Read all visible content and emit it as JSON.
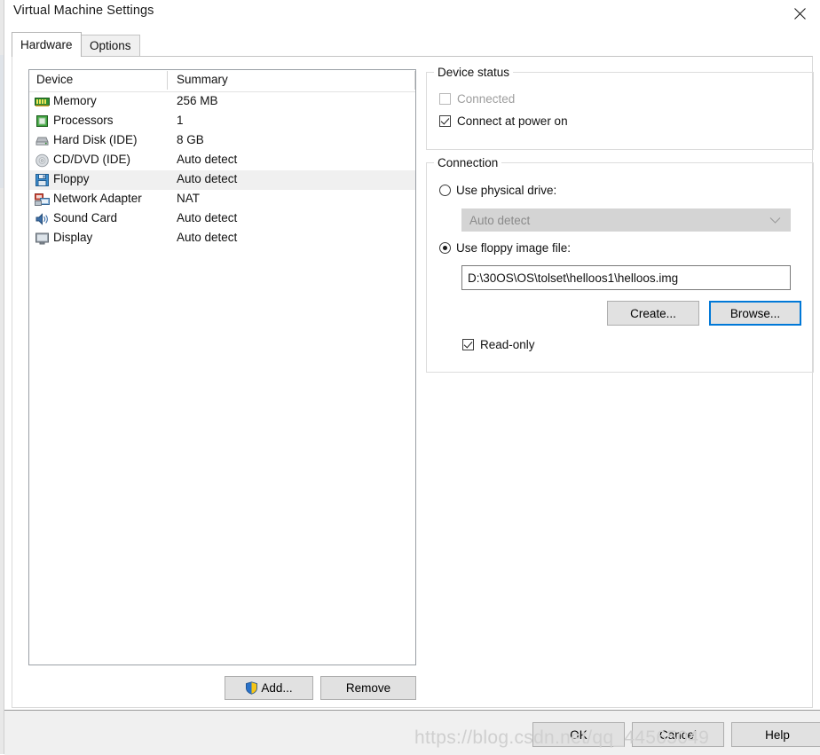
{
  "window": {
    "title": "Virtual Machine Settings",
    "close_icon": "close-icon"
  },
  "tabs": [
    {
      "label": "Hardware",
      "active": true
    },
    {
      "label": "Options",
      "active": false
    }
  ],
  "device_list": {
    "columns": [
      "Device",
      "Summary"
    ],
    "rows": [
      {
        "icon": "memory-icon",
        "device": "Memory",
        "summary": "256 MB",
        "selected": false
      },
      {
        "icon": "processor-icon",
        "device": "Processors",
        "summary": "1",
        "selected": false
      },
      {
        "icon": "hard-disk-icon",
        "device": "Hard Disk (IDE)",
        "summary": "8 GB",
        "selected": false
      },
      {
        "icon": "cd-dvd-icon",
        "device": "CD/DVD (IDE)",
        "summary": "Auto detect",
        "selected": false
      },
      {
        "icon": "floppy-icon",
        "device": "Floppy",
        "summary": "Auto detect",
        "selected": true
      },
      {
        "icon": "network-adapter-icon",
        "device": "Network Adapter",
        "summary": "NAT",
        "selected": false
      },
      {
        "icon": "sound-card-icon",
        "device": "Sound Card",
        "summary": "Auto detect",
        "selected": false
      },
      {
        "icon": "display-icon",
        "device": "Display",
        "summary": "Auto detect",
        "selected": false
      }
    ]
  },
  "list_buttons": {
    "add_label": "Add...",
    "remove_label": "Remove"
  },
  "device_status": {
    "legend": "Device status",
    "connected": {
      "label": "Connected",
      "checked": false,
      "disabled": true
    },
    "connect_at_power_on": {
      "label": "Connect at power on",
      "checked": true,
      "disabled": false
    }
  },
  "connection": {
    "legend": "Connection",
    "use_physical_drive": {
      "label": "Use physical drive:",
      "selected": false
    },
    "physical_drive_value": "Auto detect",
    "use_floppy_image": {
      "label": "Use floppy image file:",
      "selected": true
    },
    "image_path": "D:\\30OS\\OS\\tolset\\helloos1\\helloos.img",
    "create_label": "Create...",
    "browse_label": "Browse...",
    "read_only": {
      "label": "Read-only",
      "checked": true
    }
  },
  "footer": {
    "ok_label": "OK",
    "cancel_label": "Cancel",
    "help_label": "Help"
  },
  "watermark": {
    "text": "https://blog.csdn.net/qq_44565049"
  },
  "colors": {
    "accent_focus": "#0078d7",
    "selection_row": "#f0f0f0",
    "dialog_bg": "#ffffff",
    "footer_bg": "#f0f0f0",
    "disabled_text": "#9d9d9d"
  }
}
